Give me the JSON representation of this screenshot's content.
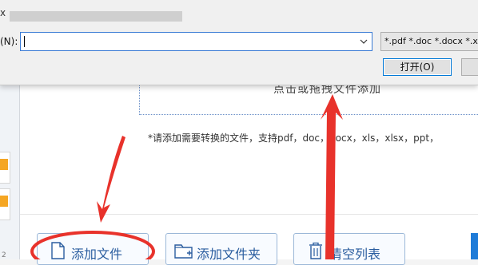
{
  "dialog": {
    "title_char": "x",
    "filename_label": "(N):",
    "filename_value": "",
    "filetype_selected": "*.pdf *.doc *.docx *.x",
    "open_label": "打开(O)"
  },
  "app": {
    "drop_hint": "点击或拖拽文件添加",
    "support_note": "*请添加需要转换的文件，支持pdf，doc，docx，xls，xlsx，ppt，",
    "left_number": "2",
    "buttons": {
      "add_file": "添加文件",
      "add_folder": "添加文件夹",
      "clear_list": "清空列表"
    }
  },
  "colors": {
    "accent": "#1e7bd8",
    "annotation": "#e8322b",
    "file_tag": "#f5a623"
  },
  "icons": {
    "add_file": "file-icon",
    "add_folder": "folder-plus-icon",
    "clear_list": "trash-icon",
    "dropdown": "chevron-down-icon"
  }
}
